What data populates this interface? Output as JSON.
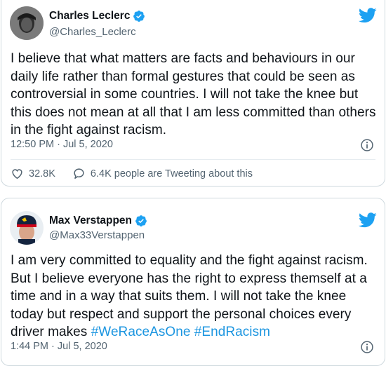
{
  "tweets": [
    {
      "author": "Charles Leclerc",
      "handle": "@Charles_Leclerc",
      "text": "I believe that what matters are facts and behaviours in our daily life rather than formal gestures that could be seen as controversial in some countries. I will not take the knee but this does not mean at all that I am less committed than others in the fight against racism.",
      "timestamp": "12:50 PM · Jul 5, 2020",
      "likes": "32.8K",
      "replies_label": "6.4K people are Tweeting about this",
      "icons": [
        "twitter-bird-icon",
        "verified-badge-icon",
        "info-icon",
        "heart-icon",
        "reply-icon"
      ]
    },
    {
      "author": "Max Verstappen",
      "handle": "@Max33Verstappen",
      "text": "I am very committed to equality and the fight against racism. But I  believe everyone has the right to express themself at a time and in a way that suits them. I will not take the knee today but respect and support the personal choices every driver makes ",
      "hashtags": [
        "#WeRaceAsOne",
        "#EndRacism"
      ],
      "timestamp": "1:44 PM · Jul 5, 2020",
      "icons": [
        "twitter-bird-icon",
        "verified-badge-icon",
        "info-icon"
      ]
    }
  ],
  "colors": {
    "brand": "#1da1f2",
    "hashtag": "#1b95e0",
    "secondary_text": "#536471",
    "border": "#cfd9de"
  }
}
